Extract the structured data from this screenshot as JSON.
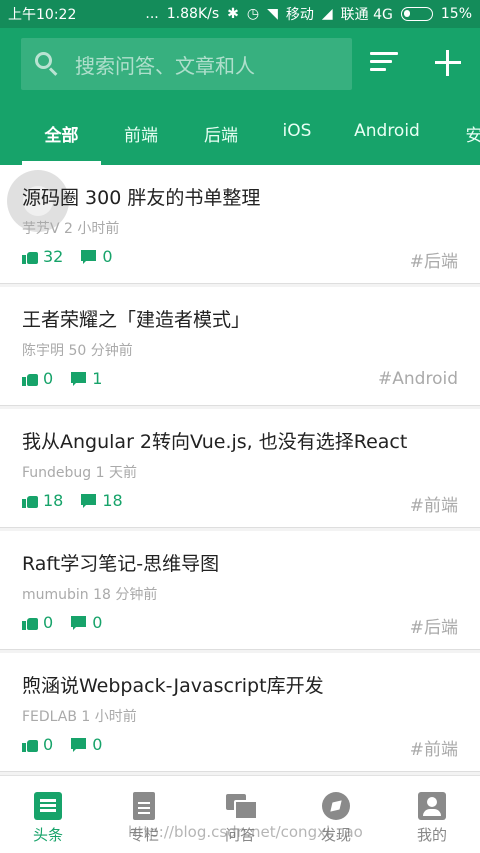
{
  "status_bar": {
    "time": "上午10:22",
    "dots": "...",
    "speed": "1.88K/s",
    "carrier1": "移动",
    "carrier2": "联通 4G",
    "battery": "15%"
  },
  "search": {
    "placeholder": "搜索问答、文章和人"
  },
  "tabs": [
    {
      "label": "全部",
      "active": true
    },
    {
      "label": "前端"
    },
    {
      "label": "后端"
    },
    {
      "label": "iOS"
    },
    {
      "label": "Android"
    },
    {
      "label": "安"
    }
  ],
  "articles": [
    {
      "title": "源码圈 300 胖友的书单整理",
      "meta": "芋艿V 2 小时前",
      "likes": "32",
      "comments": "0",
      "tag": "#后端"
    },
    {
      "title": "王者荣耀之「建造者模式」",
      "meta": "陈宇明 50 分钟前",
      "likes": "0",
      "comments": "1",
      "tag": "#Android"
    },
    {
      "title": "我从Angular 2转向Vue.js, 也没有选择React",
      "meta": "Fundebug 1 天前",
      "likes": "18",
      "comments": "18",
      "tag": "#前端"
    },
    {
      "title": "Raft学习笔记-思维导图",
      "meta": "mumubin 18 分钟前",
      "likes": "0",
      "comments": "0",
      "tag": "#后端"
    },
    {
      "title": "煦涵说Webpack-Javascript库开发",
      "meta": "FEDLAB 1 小时前",
      "likes": "0",
      "comments": "0",
      "tag": "#前端"
    }
  ],
  "bottom_nav": [
    {
      "label": "头条",
      "icon": "news-icon",
      "active": true
    },
    {
      "label": "专栏",
      "icon": "doc-icon"
    },
    {
      "label": "问答",
      "icon": "chat-icon"
    },
    {
      "label": "发现",
      "icon": "compass-icon"
    },
    {
      "label": "我的",
      "icon": "user-icon"
    }
  ],
  "watermark": "http://blog.csdn.net/congxi...ao",
  "colors": {
    "brand": "#17a36a",
    "status_bar": "#148c5a"
  }
}
